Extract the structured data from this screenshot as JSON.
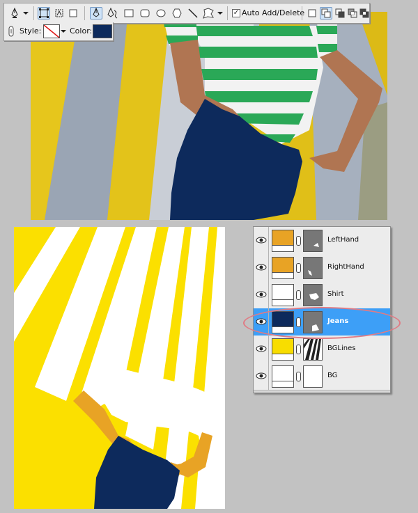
{
  "options_bar": {
    "auto_add_delete_label": "Auto Add/Delete",
    "auto_add_delete_checked": true,
    "style_label": "Style:",
    "color_label": "Color:",
    "color_value": "#0d2a5c"
  },
  "layers": [
    {
      "name": "LeftHand",
      "thumb_color": "#e8a325",
      "active": false
    },
    {
      "name": "RightHand",
      "thumb_color": "#e8a325",
      "active": false
    },
    {
      "name": "Shirt",
      "thumb_color": "#ffffff",
      "active": false
    },
    {
      "name": "Jeans",
      "thumb_color": "#0d2a5c",
      "active": true
    },
    {
      "name": "BGLines",
      "thumb_color": "#f8dd00",
      "active": false
    },
    {
      "name": "BG",
      "thumb_color": "#ffffff",
      "active": false
    }
  ],
  "colors": {
    "jeans": "#0d2a5c",
    "skin": "#e8a325",
    "yellow": "#fbe000",
    "active_layer": "#3d9ff7",
    "highlight_ellipse": "#e07b84"
  }
}
